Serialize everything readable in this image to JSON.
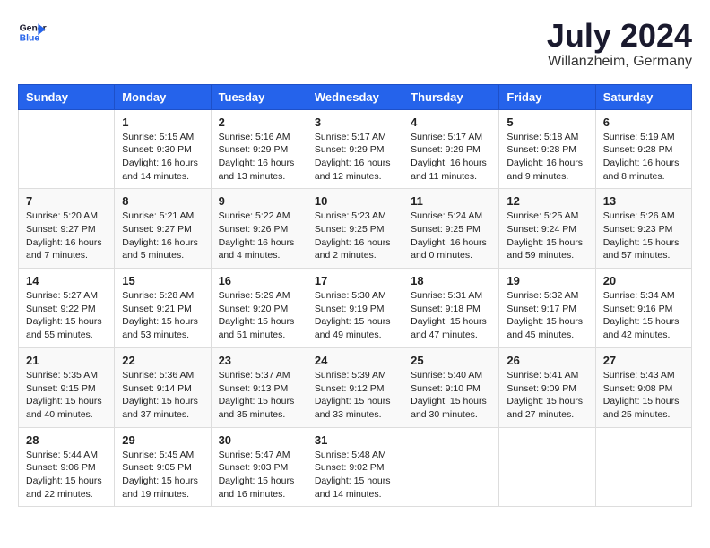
{
  "header": {
    "logo_line1": "General",
    "logo_line2": "Blue",
    "month_title": "July 2024",
    "location": "Willanzheim, Germany"
  },
  "weekdays": [
    "Sunday",
    "Monday",
    "Tuesday",
    "Wednesday",
    "Thursday",
    "Friday",
    "Saturday"
  ],
  "weeks": [
    [
      {
        "day": "",
        "info": ""
      },
      {
        "day": "1",
        "info": "Sunrise: 5:15 AM\nSunset: 9:30 PM\nDaylight: 16 hours\nand 14 minutes."
      },
      {
        "day": "2",
        "info": "Sunrise: 5:16 AM\nSunset: 9:29 PM\nDaylight: 16 hours\nand 13 minutes."
      },
      {
        "day": "3",
        "info": "Sunrise: 5:17 AM\nSunset: 9:29 PM\nDaylight: 16 hours\nand 12 minutes."
      },
      {
        "day": "4",
        "info": "Sunrise: 5:17 AM\nSunset: 9:29 PM\nDaylight: 16 hours\nand 11 minutes."
      },
      {
        "day": "5",
        "info": "Sunrise: 5:18 AM\nSunset: 9:28 PM\nDaylight: 16 hours\nand 9 minutes."
      },
      {
        "day": "6",
        "info": "Sunrise: 5:19 AM\nSunset: 9:28 PM\nDaylight: 16 hours\nand 8 minutes."
      }
    ],
    [
      {
        "day": "7",
        "info": "Sunrise: 5:20 AM\nSunset: 9:27 PM\nDaylight: 16 hours\nand 7 minutes."
      },
      {
        "day": "8",
        "info": "Sunrise: 5:21 AM\nSunset: 9:27 PM\nDaylight: 16 hours\nand 5 minutes."
      },
      {
        "day": "9",
        "info": "Sunrise: 5:22 AM\nSunset: 9:26 PM\nDaylight: 16 hours\nand 4 minutes."
      },
      {
        "day": "10",
        "info": "Sunrise: 5:23 AM\nSunset: 9:25 PM\nDaylight: 16 hours\nand 2 minutes."
      },
      {
        "day": "11",
        "info": "Sunrise: 5:24 AM\nSunset: 9:25 PM\nDaylight: 16 hours\nand 0 minutes."
      },
      {
        "day": "12",
        "info": "Sunrise: 5:25 AM\nSunset: 9:24 PM\nDaylight: 15 hours\nand 59 minutes."
      },
      {
        "day": "13",
        "info": "Sunrise: 5:26 AM\nSunset: 9:23 PM\nDaylight: 15 hours\nand 57 minutes."
      }
    ],
    [
      {
        "day": "14",
        "info": "Sunrise: 5:27 AM\nSunset: 9:22 PM\nDaylight: 15 hours\nand 55 minutes."
      },
      {
        "day": "15",
        "info": "Sunrise: 5:28 AM\nSunset: 9:21 PM\nDaylight: 15 hours\nand 53 minutes."
      },
      {
        "day": "16",
        "info": "Sunrise: 5:29 AM\nSunset: 9:20 PM\nDaylight: 15 hours\nand 51 minutes."
      },
      {
        "day": "17",
        "info": "Sunrise: 5:30 AM\nSunset: 9:19 PM\nDaylight: 15 hours\nand 49 minutes."
      },
      {
        "day": "18",
        "info": "Sunrise: 5:31 AM\nSunset: 9:18 PM\nDaylight: 15 hours\nand 47 minutes."
      },
      {
        "day": "19",
        "info": "Sunrise: 5:32 AM\nSunset: 9:17 PM\nDaylight: 15 hours\nand 45 minutes."
      },
      {
        "day": "20",
        "info": "Sunrise: 5:34 AM\nSunset: 9:16 PM\nDaylight: 15 hours\nand 42 minutes."
      }
    ],
    [
      {
        "day": "21",
        "info": "Sunrise: 5:35 AM\nSunset: 9:15 PM\nDaylight: 15 hours\nand 40 minutes."
      },
      {
        "day": "22",
        "info": "Sunrise: 5:36 AM\nSunset: 9:14 PM\nDaylight: 15 hours\nand 37 minutes."
      },
      {
        "day": "23",
        "info": "Sunrise: 5:37 AM\nSunset: 9:13 PM\nDaylight: 15 hours\nand 35 minutes."
      },
      {
        "day": "24",
        "info": "Sunrise: 5:39 AM\nSunset: 9:12 PM\nDaylight: 15 hours\nand 33 minutes."
      },
      {
        "day": "25",
        "info": "Sunrise: 5:40 AM\nSunset: 9:10 PM\nDaylight: 15 hours\nand 30 minutes."
      },
      {
        "day": "26",
        "info": "Sunrise: 5:41 AM\nSunset: 9:09 PM\nDaylight: 15 hours\nand 27 minutes."
      },
      {
        "day": "27",
        "info": "Sunrise: 5:43 AM\nSunset: 9:08 PM\nDaylight: 15 hours\nand 25 minutes."
      }
    ],
    [
      {
        "day": "28",
        "info": "Sunrise: 5:44 AM\nSunset: 9:06 PM\nDaylight: 15 hours\nand 22 minutes."
      },
      {
        "day": "29",
        "info": "Sunrise: 5:45 AM\nSunset: 9:05 PM\nDaylight: 15 hours\nand 19 minutes."
      },
      {
        "day": "30",
        "info": "Sunrise: 5:47 AM\nSunset: 9:03 PM\nDaylight: 15 hours\nand 16 minutes."
      },
      {
        "day": "31",
        "info": "Sunrise: 5:48 AM\nSunset: 9:02 PM\nDaylight: 15 hours\nand 14 minutes."
      },
      {
        "day": "",
        "info": ""
      },
      {
        "day": "",
        "info": ""
      },
      {
        "day": "",
        "info": ""
      }
    ]
  ]
}
